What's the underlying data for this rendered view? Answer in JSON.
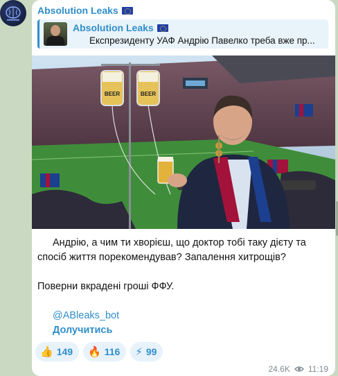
{
  "channel": {
    "name": "Absolution Leaks",
    "flag_icon": "eu-flag-icon"
  },
  "reply": {
    "title": "Absolution Leaks",
    "text": "Експрезиденту УАФ Андрію Павелко треба вже пр..."
  },
  "photo": {
    "iv_label_1": "BEER",
    "iv_label_2": "BEER"
  },
  "message": {
    "paragraph1": "Андрію, а чим ти хворієш, що доктор тобі таку дієту та спосіб життя порекомендував? Запалення хитрощів?",
    "paragraph2": "Поверни вкрадені гроші ФФУ.",
    "link1": "@ABleaks_bot",
    "link2": "Долучитись"
  },
  "reactions": [
    {
      "emoji": "👍",
      "icon": "thumbs-up-icon",
      "count": "149"
    },
    {
      "emoji": "🔥",
      "icon": "fire-icon",
      "count": "116"
    },
    {
      "emoji": "⚡",
      "icon": "lightning-icon",
      "count": "99"
    }
  ],
  "meta": {
    "views": "24.6K",
    "time": "11:19"
  },
  "colors": {
    "accent": "#2f8ec9",
    "background": "#c9d9c2",
    "reaction_bg": "#e8f2fb"
  }
}
